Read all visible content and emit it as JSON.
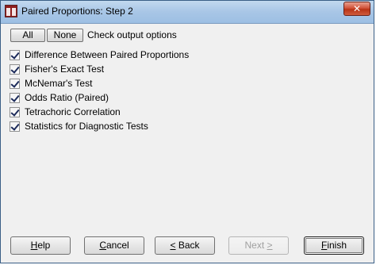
{
  "window": {
    "title": "Paired Proportions: Step 2",
    "close_glyph": "✕"
  },
  "toolbar": {
    "all_label": "All",
    "none_label": "None",
    "check_label": "Check output options"
  },
  "options": [
    {
      "label": "Difference Between Paired Proportions",
      "checked": true
    },
    {
      "label": "Fisher's Exact Test",
      "checked": true
    },
    {
      "label": "McNemar's Test",
      "checked": true
    },
    {
      "label": "Odds Ratio (Paired)",
      "checked": true
    },
    {
      "label": "Tetrachoric Correlation",
      "checked": true
    },
    {
      "label": "Statistics for Diagnostic Tests",
      "checked": true
    }
  ],
  "buttons": {
    "help": {
      "pre": "",
      "key": "H",
      "post": "elp"
    },
    "cancel": {
      "pre": "",
      "key": "C",
      "post": "ancel"
    },
    "back": {
      "pre": "",
      "key": "<",
      "post": " Back"
    },
    "next": {
      "pre": "Next ",
      "key": ">",
      "post": ""
    },
    "finish": {
      "pre": "",
      "key": "F",
      "post": "inish"
    }
  },
  "icons": {
    "app": "app-window-icon",
    "close": "close-icon",
    "check": "checkmark-icon"
  },
  "colors": {
    "titlebar": "#a8c6e6",
    "close_button": "#c4452a",
    "checkmark": "#1c2b5a",
    "disabled_text": "#a0a0a0"
  }
}
